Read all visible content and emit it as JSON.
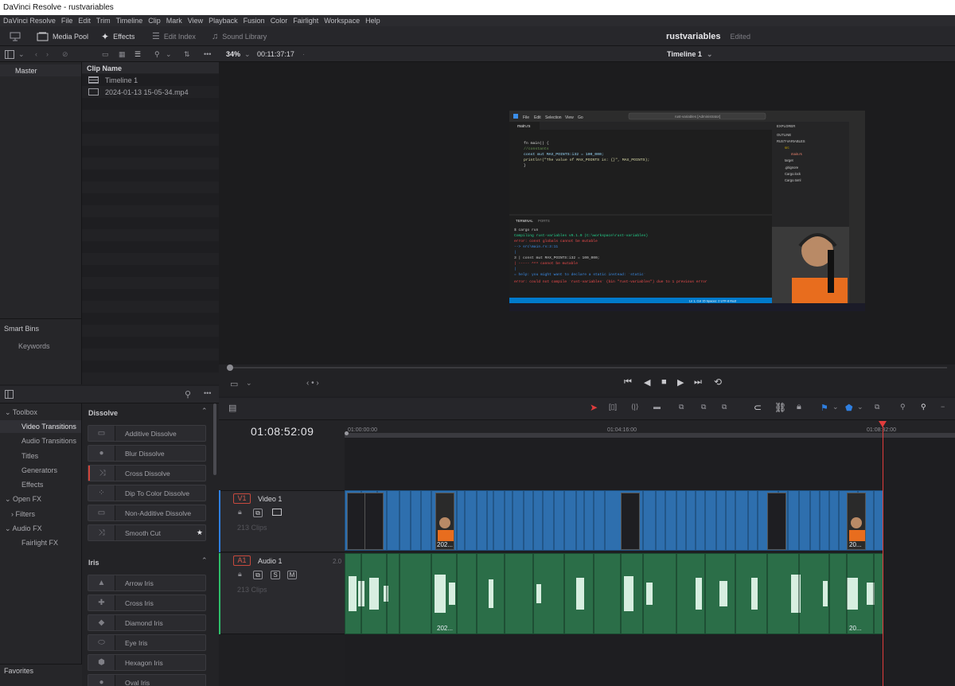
{
  "titlebar": {
    "title": "DaVinci Resolve - rustvariables"
  },
  "menu": [
    "DaVinci Resolve",
    "File",
    "Edit",
    "Trim",
    "Timeline",
    "Clip",
    "Mark",
    "View",
    "Playback",
    "Fusion",
    "Color",
    "Fairlight",
    "Workspace",
    "Help"
  ],
  "toolbar": {
    "media_pool": "Media Pool",
    "effects": "Effects",
    "edit_index": "Edit Index",
    "sound_library": "Sound Library",
    "project_name": "rustvariables",
    "project_status": "Edited"
  },
  "viewer_bar": {
    "zoom": "34%",
    "source_timecode": "00:11:37:17",
    "timeline_name": "Timeline 1"
  },
  "bins": {
    "master": "Master",
    "smart_bins": "Smart Bins",
    "keywords": "Keywords"
  },
  "clip_list": {
    "header": "Clip Name",
    "items": [
      {
        "name": "Timeline 1",
        "icon": "timeline-icon"
      },
      {
        "name": "2024-01-13 15-05-34.mp4",
        "icon": "video-clip-icon"
      }
    ]
  },
  "effects_tree": {
    "toolbox": "Toolbox",
    "video_transitions": "Video Transitions",
    "audio_transitions": "Audio Transitions",
    "titles": "Titles",
    "generators": "Generators",
    "effects": "Effects",
    "open_fx": "Open FX",
    "filters": "Filters",
    "audio_fx": "Audio FX",
    "fairlight_fx": "Fairlight FX",
    "favorites": "Favorites"
  },
  "effects_list": {
    "dissolve_header": "Dissolve",
    "dissolve": [
      "Additive Dissolve",
      "Blur Dissolve",
      "Cross Dissolve",
      "Dip To Color Dissolve",
      "Non-Additive Dissolve",
      "Smooth Cut"
    ],
    "iris_header": "Iris",
    "iris": [
      "Arrow Iris",
      "Cross Iris",
      "Diamond Iris",
      "Eye Iris",
      "Hexagon Iris",
      "Oval Iris"
    ]
  },
  "timeline": {
    "timecode": "01:08:52:09",
    "ruler": [
      "01:00:00:00",
      "01:04:16:00",
      "01:08:32:00"
    ],
    "video_track": {
      "id": "V1",
      "name": "Video 1",
      "clips": "213 Clips"
    },
    "audio_track": {
      "id": "A1",
      "name": "Audio 1",
      "clips": "213 Clips",
      "channels": "2.0",
      "solo": "S",
      "mute": "M"
    },
    "clip_label_short": "202...",
    "clip_label_end": "20..."
  },
  "preview": {
    "menu": [
      "File",
      "Edit",
      "Selection",
      "View",
      "Go"
    ],
    "search": "rust-variables [Administrator]",
    "tab": "main.rs",
    "code_lines": [
      "fn main() {",
      "    //constants",
      "    const mut MAX_POINTS:i32 = 100_000;",
      "    println!(\"The value of MAX_POINTS is: {}\", MAX_POINTS);",
      "}"
    ],
    "terminal_tabs": [
      "TERMINAL",
      "PORTS"
    ],
    "terminal_lines": [
      "$ cargo run",
      "   Compiling rust-variables v0.1.0 (C:\\workspace\\rust-variables)",
      "error: const globals cannot be mutable",
      " --> src\\main.rs:3:11",
      "  |",
      "3 |     const mut MAX_POINTS:i32 = 100_000;",
      "  |     ----- ^^^ cannot be mutable",
      "  |",
      "  = help: you might want to declare a static instead: `static`",
      "error: could not compile `rust-variables` (bin \"rust-variables\") due to 1 previous error"
    ],
    "explorer": [
      "EXPLORER",
      "OUTLINE",
      "RUST-VARIABLES",
      "src",
      "main.rs",
      "target",
      ".gitignore",
      "Cargo.lock",
      "Cargo.toml"
    ],
    "statusbar": "Ln 1, Col 15   Spaces: 2   UTF-8   Rust"
  }
}
